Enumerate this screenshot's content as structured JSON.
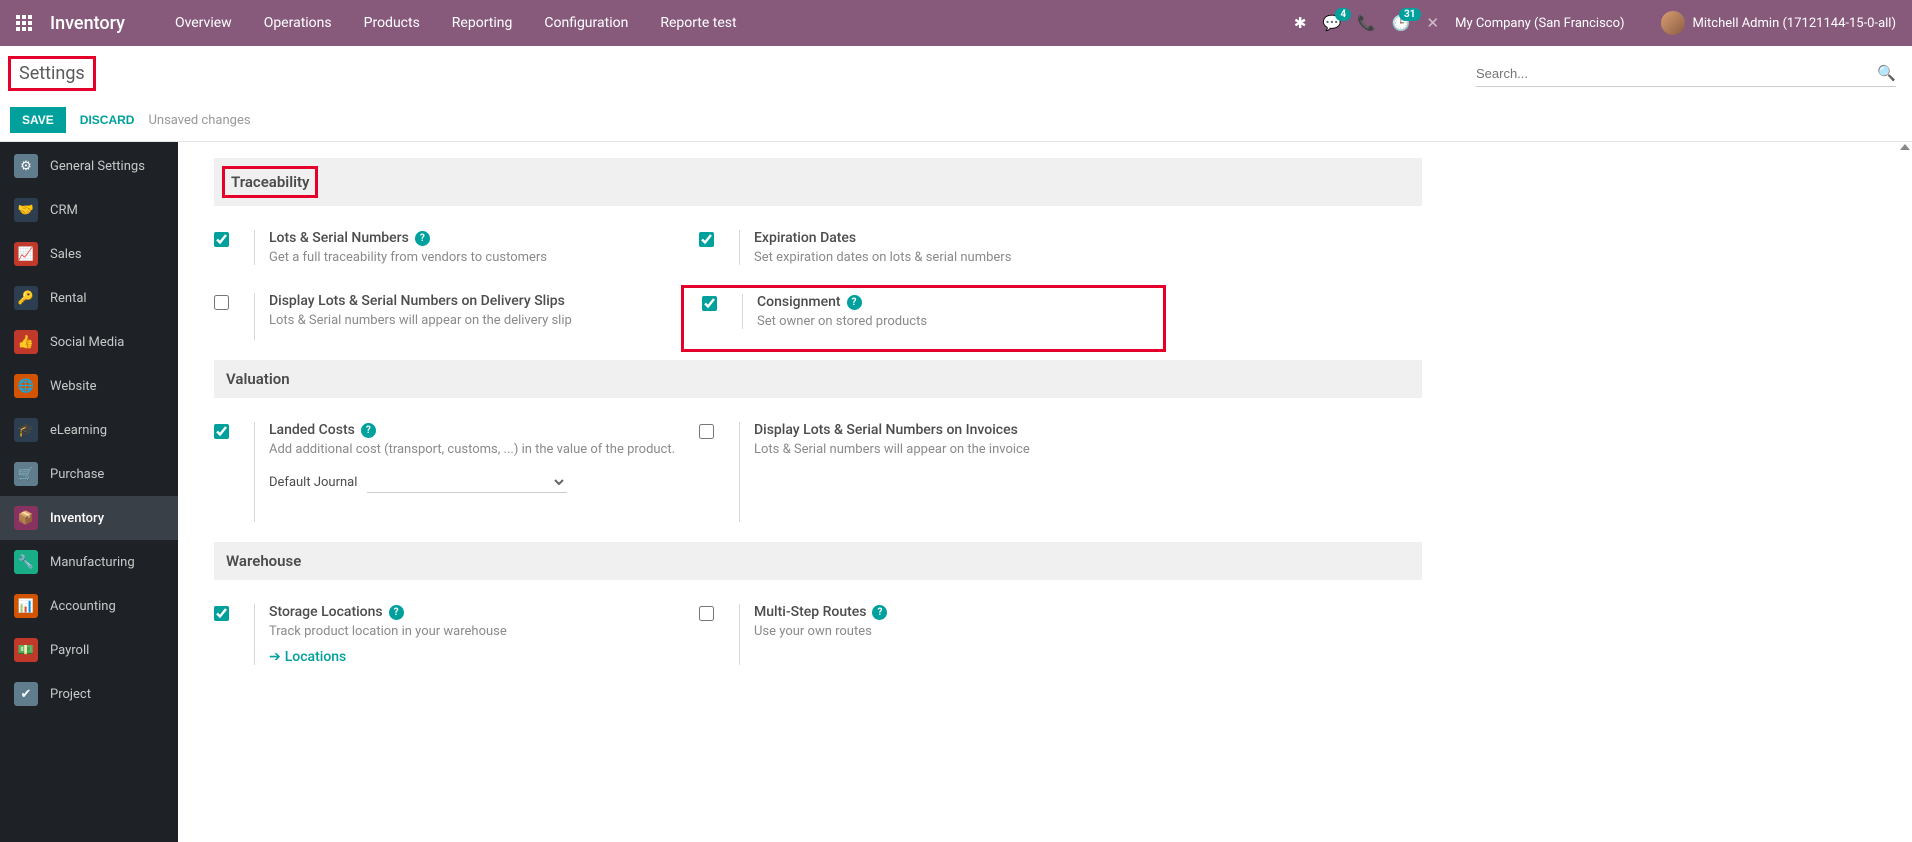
{
  "navbar": {
    "module": "Inventory",
    "menu": [
      "Overview",
      "Operations",
      "Products",
      "Reporting",
      "Configuration",
      "Reporte test"
    ],
    "chat_badge": "4",
    "activity_badge": "31",
    "company": "My Company (San Francisco)",
    "user": "Mitchell Admin (17121144-15-0-all)"
  },
  "header": {
    "title": "Settings",
    "search_placeholder": "Search...",
    "save": "SAVE",
    "discard": "DISCARD",
    "status": "Unsaved changes"
  },
  "sidebar": {
    "items": [
      {
        "label": "General Settings"
      },
      {
        "label": "CRM"
      },
      {
        "label": "Sales"
      },
      {
        "label": "Rental"
      },
      {
        "label": "Social Media"
      },
      {
        "label": "Website"
      },
      {
        "label": "eLearning"
      },
      {
        "label": "Purchase"
      },
      {
        "label": "Inventory"
      },
      {
        "label": "Manufacturing"
      },
      {
        "label": "Accounting"
      },
      {
        "label": "Payroll"
      },
      {
        "label": "Project"
      }
    ]
  },
  "sections": {
    "traceability": {
      "title": "Traceability",
      "lots": {
        "title": "Lots & Serial Numbers",
        "desc": "Get a full traceability from vendors to customers"
      },
      "display_delivery": {
        "title": "Display Lots & Serial Numbers on Delivery Slips",
        "desc": "Lots & Serial numbers will appear on the delivery slip"
      },
      "expiration": {
        "title": "Expiration Dates",
        "desc": "Set expiration dates on lots & serial numbers"
      },
      "consignment": {
        "title": "Consignment",
        "desc": "Set owner on stored products"
      }
    },
    "valuation": {
      "title": "Valuation",
      "landed": {
        "title": "Landed Costs",
        "desc": "Add additional cost (transport, customs, ...) in the value of the product.",
        "journal_label": "Default Journal"
      },
      "display_invoice": {
        "title": "Display Lots & Serial Numbers on Invoices",
        "desc": "Lots & Serial numbers will appear on the invoice"
      }
    },
    "warehouse": {
      "title": "Warehouse",
      "storage": {
        "title": "Storage Locations",
        "desc": "Track product location in your warehouse",
        "link": "Locations"
      },
      "routes": {
        "title": "Multi-Step Routes",
        "desc": "Use your own routes"
      }
    }
  }
}
